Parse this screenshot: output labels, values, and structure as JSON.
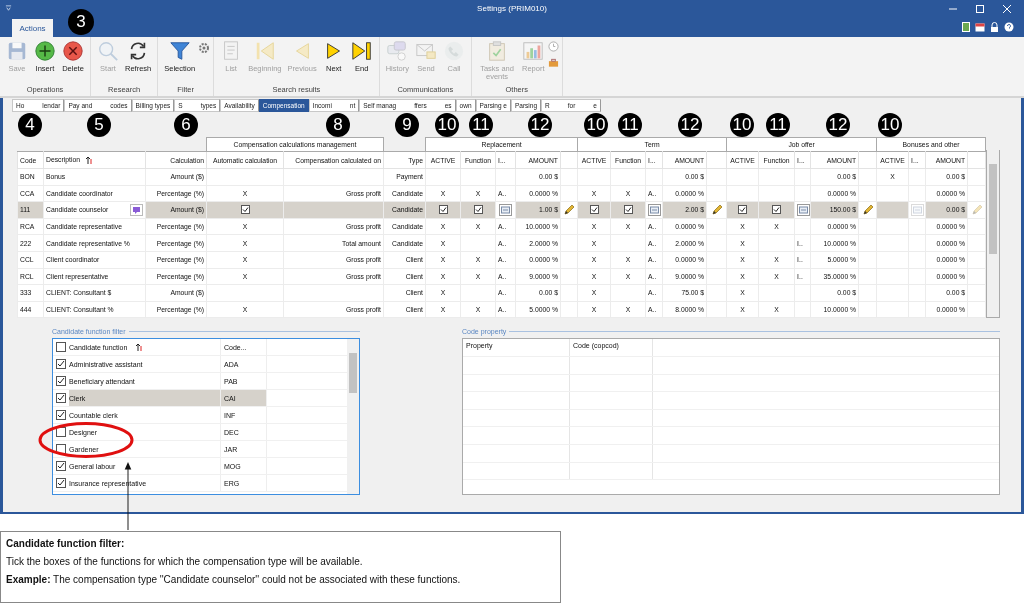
{
  "window": {
    "title": "Settings (PRIM010)"
  },
  "ribbon": {
    "tab": "Actions",
    "groups": [
      {
        "label": "Operations",
        "buttons": [
          {
            "label": "Save",
            "disabled": true
          },
          {
            "label": "Insert",
            "disabled": false
          },
          {
            "label": "Delete",
            "disabled": false
          }
        ]
      },
      {
        "label": "Research",
        "buttons": [
          {
            "label": "Start",
            "disabled": true
          },
          {
            "label": "Refresh",
            "disabled": false
          }
        ]
      },
      {
        "label": "Filter",
        "buttons": [
          {
            "label": "Selection",
            "disabled": false
          }
        ]
      },
      {
        "label": "Search results",
        "buttons": [
          {
            "label": "List",
            "disabled": true
          },
          {
            "label": "Beginning",
            "disabled": true
          },
          {
            "label": "Previous",
            "disabled": true
          },
          {
            "label": "Next",
            "disabled": false
          },
          {
            "label": "End",
            "disabled": false
          }
        ]
      },
      {
        "label": "Communications",
        "buttons": [
          {
            "label": "History",
            "disabled": true
          },
          {
            "label": "Send",
            "disabled": true
          },
          {
            "label": "Call",
            "disabled": true
          }
        ]
      },
      {
        "label": "Others",
        "buttons": [
          {
            "label": "Tasks and events",
            "disabled": true
          },
          {
            "label": "Report",
            "disabled": true
          }
        ]
      }
    ]
  },
  "tabs": [
    {
      "label": [
        "Ho",
        "lendar"
      ],
      "selected": false
    },
    {
      "label": [
        "Pay and",
        "codes"
      ],
      "selected": false
    },
    {
      "label": [
        "Billing types"
      ],
      "selected": false
    },
    {
      "label": [
        "S",
        "types"
      ],
      "selected": false
    },
    {
      "label": [
        "Availability"
      ],
      "selected": false
    },
    {
      "label": [
        "Compensation"
      ],
      "selected": true
    },
    {
      "label": [
        "Incomi",
        "nt"
      ],
      "selected": false
    },
    {
      "label": [
        "Self manag",
        "ffers",
        "es"
      ],
      "selected": false
    },
    {
      "label": [
        "own"
      ],
      "selected": false
    },
    {
      "label": [
        "Parsing e"
      ],
      "selected": false
    },
    {
      "label": [
        "Parsing"
      ],
      "selected": false
    },
    {
      "label": [
        "R",
        "for",
        "e"
      ],
      "selected": false
    }
  ],
  "table": {
    "groups": [
      {
        "columns": [
          {
            "label": "Code",
            "sorted": false
          },
          {
            "label": "Description",
            "sorted": true
          },
          {
            "label": "Calculation",
            "sorted": false
          }
        ]
      },
      {
        "title": "Compensation calculations management",
        "columns": [
          {
            "label": "Automatic calculation",
            "sorted": false
          },
          {
            "label": "Compensation calculated on",
            "sorted": false
          }
        ]
      },
      {
        "columns": [
          {
            "label": "Type",
            "sorted": false
          }
        ]
      },
      {
        "title": "Replacement",
        "columns": [
          {
            "label": "ACTIVE",
            "sorted": false
          },
          {
            "label": "Function",
            "sorted": false
          },
          {
            "label": "I...",
            "sorted": false
          },
          {
            "label": "AMOUNT",
            "sorted": false
          },
          {}
        ]
      },
      {
        "title": "Term",
        "columns": [
          {
            "label": "ACTIVE",
            "sorted": false
          },
          {
            "label": "Function",
            "sorted": false
          },
          {
            "label": "I...",
            "sorted": false
          },
          {
            "label": "AMOUNT",
            "sorted": false
          },
          {}
        ]
      },
      {
        "title": "Job offer",
        "columns": [
          {
            "label": "ACTIVE",
            "sorted": false
          },
          {
            "label": "Function",
            "sorted": false
          },
          {
            "label": "I...",
            "sorted": false
          },
          {
            "label": "AMOUNT",
            "sorted": false
          },
          {}
        ]
      },
      {
        "title": "Bonuses and other",
        "columns": [
          {
            "label": "ACTIVE",
            "sorted": false
          },
          {
            "label": "I...",
            "sorted": false
          },
          {
            "label": "AMOUNT",
            "sorted": false
          },
          {}
        ]
      }
    ],
    "rows": [
      {
        "selected": false,
        "cells": [
          "BON",
          "Bonus",
          "Amount ($)",
          null,
          null,
          "Payment",
          null,
          null,
          null,
          "0.00 $",
          null,
          null,
          null,
          null,
          "0.00 $",
          null,
          null,
          null,
          null,
          "0.00 $",
          null,
          "X",
          null,
          "0.00 $",
          null
        ]
      },
      {
        "selected": false,
        "cells": [
          "CCA",
          "Candidate  coordinator",
          "Percentage (%)",
          "X",
          "Gross profit",
          "Candidate",
          "X",
          "X",
          "A..",
          "0.0000 %",
          null,
          "X",
          "X",
          "A..",
          "0.0000 %",
          null,
          null,
          null,
          null,
          "0.0000 %",
          null,
          null,
          null,
          "0.0000 %",
          null
        ]
      },
      {
        "selected": true,
        "cells": [
          "111",
          {
            "kind": "note",
            "text": "Candidate counselor"
          },
          "Amount ($)",
          {
            "kind": "check",
            "checked": true
          },
          null,
          "Candidate",
          {
            "kind": "check",
            "checked": true
          },
          {
            "kind": "check",
            "checked": true
          },
          {
            "kind": "sql",
            "disabled": false
          },
          "1.00 $",
          {
            "kind": "pencil",
            "disabled": false
          },
          {
            "kind": "check",
            "checked": true
          },
          {
            "kind": "check",
            "checked": true
          },
          {
            "kind": "sql",
            "disabled": false
          },
          "2.00 $",
          {
            "kind": "pencil",
            "disabled": false
          },
          {
            "kind": "check",
            "checked": true
          },
          {
            "kind": "check",
            "checked": true
          },
          {
            "kind": "sql",
            "disabled": false
          },
          "150.00 $",
          {
            "kind": "pencil",
            "disabled": false
          },
          null,
          {
            "kind": "sql",
            "disabled": true
          },
          "0.00 $",
          {
            "kind": "pencil",
            "disabled": true
          }
        ]
      },
      {
        "selected": false,
        "cells": [
          "RCA",
          "Candidate representative",
          "Percentage (%)",
          "X",
          "Gross profit",
          "Candidate",
          "X",
          "X",
          "A..",
          "10.0000 %",
          null,
          "X",
          "X",
          "A..",
          "0.0000 %",
          null,
          "X",
          "X",
          null,
          "0.0000 %",
          null,
          null,
          null,
          "0.0000 %",
          null
        ]
      },
      {
        "selected": false,
        "cells": [
          "222",
          "Candidate representative %",
          "Percentage (%)",
          "X",
          "Total amount",
          "Candidate",
          "X",
          null,
          "A..",
          "2.0000 %",
          null,
          "X",
          null,
          "A..",
          "2.0000 %",
          null,
          "X",
          null,
          "I..",
          "10.0000 %",
          null,
          null,
          null,
          "0.0000 %",
          null
        ]
      },
      {
        "selected": false,
        "cells": [
          "CCL",
          "Client coordinator",
          "Percentage (%)",
          "X",
          "Gross profit",
          "Client",
          "X",
          "X",
          "A..",
          "0.0000 %",
          null,
          "X",
          "X",
          "A..",
          "0.0000 %",
          null,
          "X",
          "X",
          "I..",
          "5.0000 %",
          null,
          null,
          null,
          "0.0000 %",
          null
        ]
      },
      {
        "selected": false,
        "cells": [
          "RCL",
          "Client representative",
          "Percentage (%)",
          "X",
          "Gross profit",
          "Client",
          "X",
          "X",
          "A..",
          "9.0000 %",
          null,
          "X",
          "X",
          "A..",
          "9.0000 %",
          null,
          "X",
          "X",
          "I..",
          "35.0000 %",
          null,
          null,
          null,
          "0.0000 %",
          null
        ]
      },
      {
        "selected": false,
        "cells": [
          "333",
          "CLIENT: Consultant $",
          "Amount ($)",
          null,
          null,
          "Client",
          "X",
          null,
          "A..",
          "0.00 $",
          null,
          "X",
          null,
          "A..",
          "75.00 $",
          null,
          "X",
          null,
          null,
          "0.00 $",
          null,
          null,
          null,
          "0.00 $",
          null
        ]
      },
      {
        "selected": false,
        "cells": [
          "444",
          "CLIENT: Consultant %",
          "Percentage (%)",
          "X",
          "Gross profit",
          "Client",
          "X",
          "X",
          "A..",
          "5.0000 %",
          null,
          "X",
          "X",
          "A..",
          "8.0000 %",
          null,
          "X",
          "X",
          null,
          "10.0000 %",
          null,
          null,
          null,
          "0.0000 %",
          null
        ]
      }
    ]
  },
  "function_filter": {
    "legend": "Candidate function filter",
    "header": {
      "label": "Candidate function",
      "code": "Code...",
      "checked": false
    },
    "rows": [
      {
        "label": "Administrative assistant",
        "code": "ADA",
        "checked": true,
        "selected": false
      },
      {
        "label": "Beneficiary attendant",
        "code": "PAB",
        "checked": true,
        "selected": false
      },
      {
        "label": "Clerk",
        "code": "CAI",
        "checked": true,
        "selected": true
      },
      {
        "label": "Countable clerk",
        "code": "INF",
        "checked": true,
        "selected": false
      },
      {
        "label": "Designer",
        "code": "DEC",
        "checked": false,
        "selected": false
      },
      {
        "label": "Gardener",
        "code": "JAR",
        "checked": false,
        "selected": false
      },
      {
        "label": "General labour",
        "code": "MOG",
        "checked": true,
        "selected": false
      },
      {
        "label": "Insurance representative",
        "code": "ERG",
        "checked": true,
        "selected": false
      }
    ]
  },
  "code_property": {
    "legend": "Code property",
    "columns": [
      "Property",
      "Code (copcod)"
    ]
  },
  "badges": [
    "3",
    "4",
    "5",
    "6",
    "8",
    "9",
    "10",
    "11",
    "12",
    "10",
    "11",
    "12",
    "10",
    "11",
    "12",
    "10"
  ],
  "callout": {
    "title": "Candidate function filter:",
    "text": "Tick the boxes of the functions for which the compensation type will be available.",
    "example": "**Example:** The compensation type ''Candidate counselor'' could not be associated with these functions."
  }
}
